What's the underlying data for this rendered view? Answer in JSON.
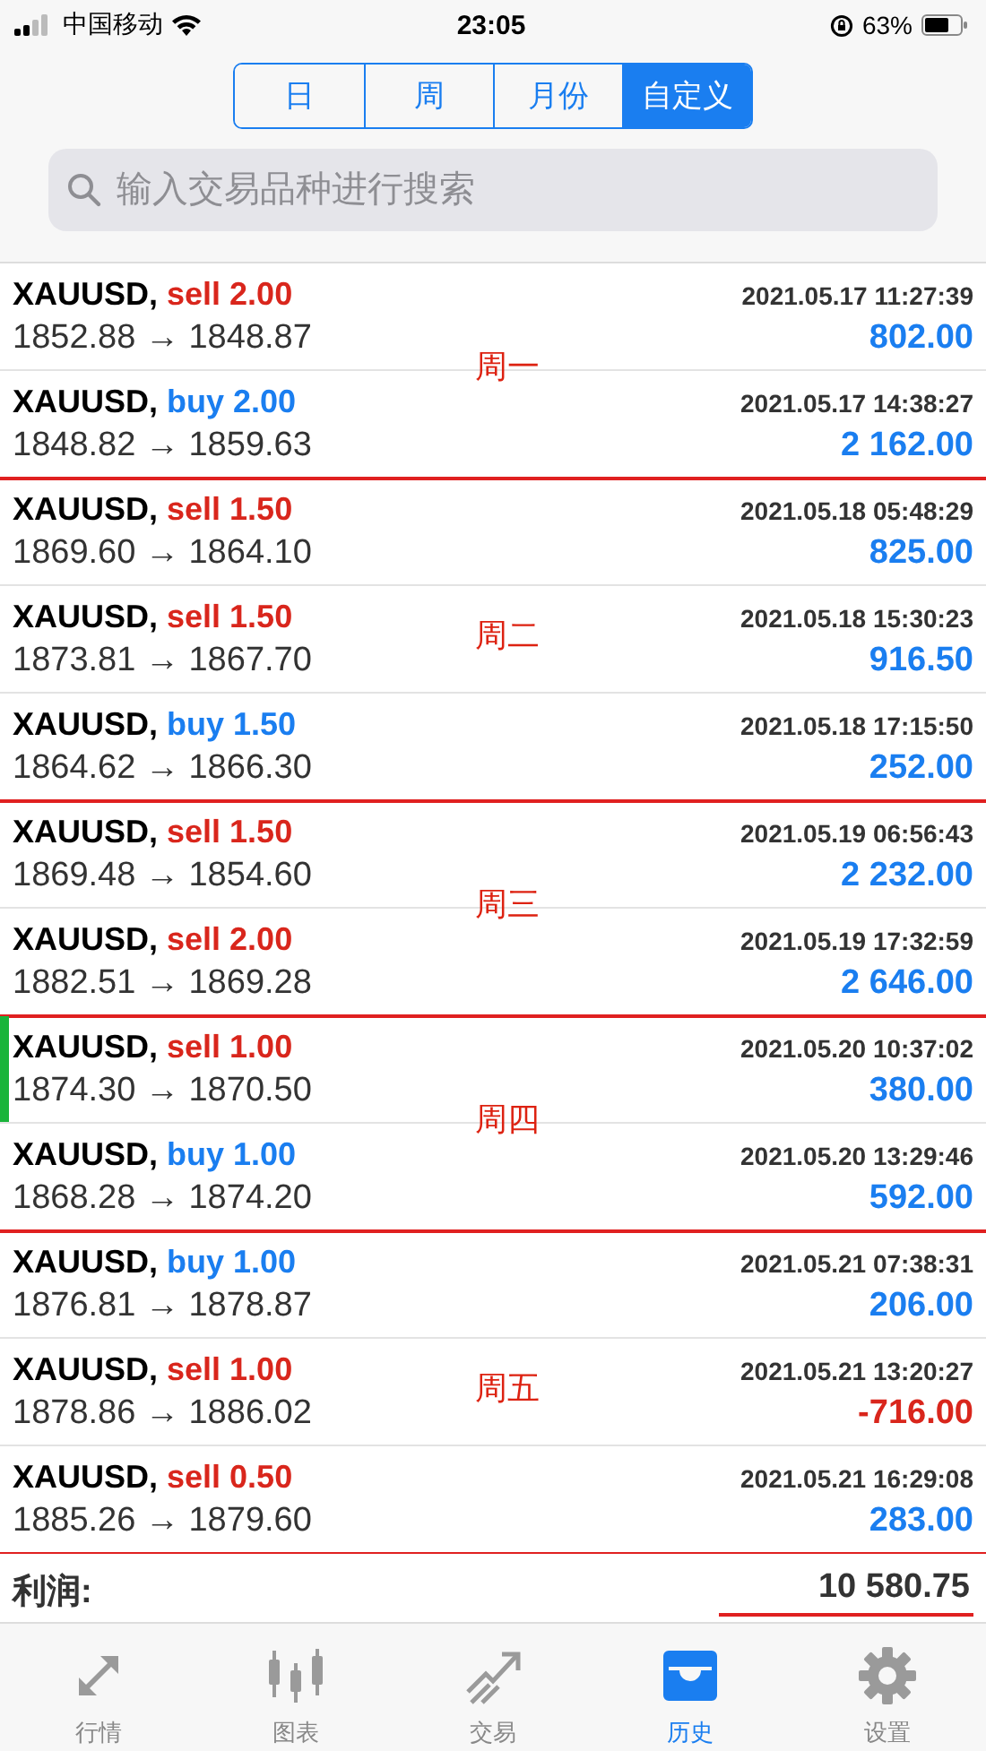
{
  "status_bar": {
    "carrier": "中国移动",
    "time": "23:05",
    "battery": "63%"
  },
  "tabs": [
    {
      "label": "日",
      "selected": false
    },
    {
      "label": "周",
      "selected": false
    },
    {
      "label": "月份",
      "selected": false
    },
    {
      "label": "自定义",
      "selected": true
    }
  ],
  "search": {
    "placeholder": "输入交易品种进行搜索"
  },
  "weeks": [
    {
      "annotation": "周一",
      "trades": [
        {
          "symbol": "XAUUSD,",
          "kind": "sell",
          "order": "sell 2.00",
          "time": "2021.05.17 11:27:39",
          "prices": "1852.88 → 1848.87",
          "profit": "802.00",
          "loss": false,
          "marked": false
        },
        {
          "symbol": "XAUUSD,",
          "kind": "buy",
          "order": "buy 2.00",
          "time": "2021.05.17 14:38:27",
          "prices": "1848.82 → 1859.63",
          "profit": "2 162.00",
          "loss": false,
          "marked": false
        }
      ]
    },
    {
      "annotation": "周二",
      "trades": [
        {
          "symbol": "XAUUSD,",
          "kind": "sell",
          "order": "sell 1.50",
          "time": "2021.05.18 05:48:29",
          "prices": "1869.60 → 1864.10",
          "profit": "825.00",
          "loss": false,
          "marked": false
        },
        {
          "symbol": "XAUUSD,",
          "kind": "sell",
          "order": "sell 1.50",
          "time": "2021.05.18 15:30:23",
          "prices": "1873.81 → 1867.70",
          "profit": "916.50",
          "loss": false,
          "marked": false
        },
        {
          "symbol": "XAUUSD,",
          "kind": "buy",
          "order": "buy 1.50",
          "time": "2021.05.18 17:15:50",
          "prices": "1864.62 → 1866.30",
          "profit": "252.00",
          "loss": false,
          "marked": false
        }
      ]
    },
    {
      "annotation": "周三",
      "trades": [
        {
          "symbol": "XAUUSD,",
          "kind": "sell",
          "order": "sell 1.50",
          "time": "2021.05.19 06:56:43",
          "prices": "1869.48 → 1854.60",
          "profit": "2 232.00",
          "loss": false,
          "marked": false
        },
        {
          "symbol": "XAUUSD,",
          "kind": "sell",
          "order": "sell 2.00",
          "time": "2021.05.19 17:32:59",
          "prices": "1882.51 → 1869.28",
          "profit": "2 646.00",
          "loss": false,
          "marked": false
        }
      ]
    },
    {
      "annotation": "周四",
      "trades": [
        {
          "symbol": "XAUUSD,",
          "kind": "sell",
          "order": "sell 1.00",
          "time": "2021.05.20 10:37:02",
          "prices": "1874.30 → 1870.50",
          "profit": "380.00",
          "loss": false,
          "marked": true
        },
        {
          "symbol": "XAUUSD,",
          "kind": "buy",
          "order": "buy 1.00",
          "time": "2021.05.20 13:29:46",
          "prices": "1868.28 → 1874.20",
          "profit": "592.00",
          "loss": false,
          "marked": false
        }
      ]
    },
    {
      "annotation": "周五",
      "trades": [
        {
          "symbol": "XAUUSD,",
          "kind": "buy",
          "order": "buy 1.00",
          "time": "2021.05.21 07:38:31",
          "prices": "1876.81 → 1878.87",
          "profit": "206.00",
          "loss": false,
          "marked": false
        },
        {
          "symbol": "XAUUSD,",
          "kind": "sell",
          "order": "sell 1.00",
          "time": "2021.05.21 13:20:27",
          "prices": "1878.86 → 1886.02",
          "profit": "-716.00",
          "loss": true,
          "marked": false
        },
        {
          "symbol": "XAUUSD,",
          "kind": "sell",
          "order": "sell 0.50",
          "time": "2021.05.21 16:29:08",
          "prices": "1885.26 → 1879.60",
          "profit": "283.00",
          "loss": false,
          "marked": false
        }
      ]
    }
  ],
  "summary": {
    "label": "利润:",
    "value": "10 580.75"
  },
  "tab_bar": [
    {
      "label": "行情",
      "kind": "quotes",
      "selected": false
    },
    {
      "label": "图表",
      "kind": "charts",
      "selected": false
    },
    {
      "label": "交易",
      "kind": "trade",
      "selected": false
    },
    {
      "label": "历史",
      "kind": "history",
      "selected": true
    },
    {
      "label": "设置",
      "kind": "settings",
      "selected": false
    }
  ]
}
